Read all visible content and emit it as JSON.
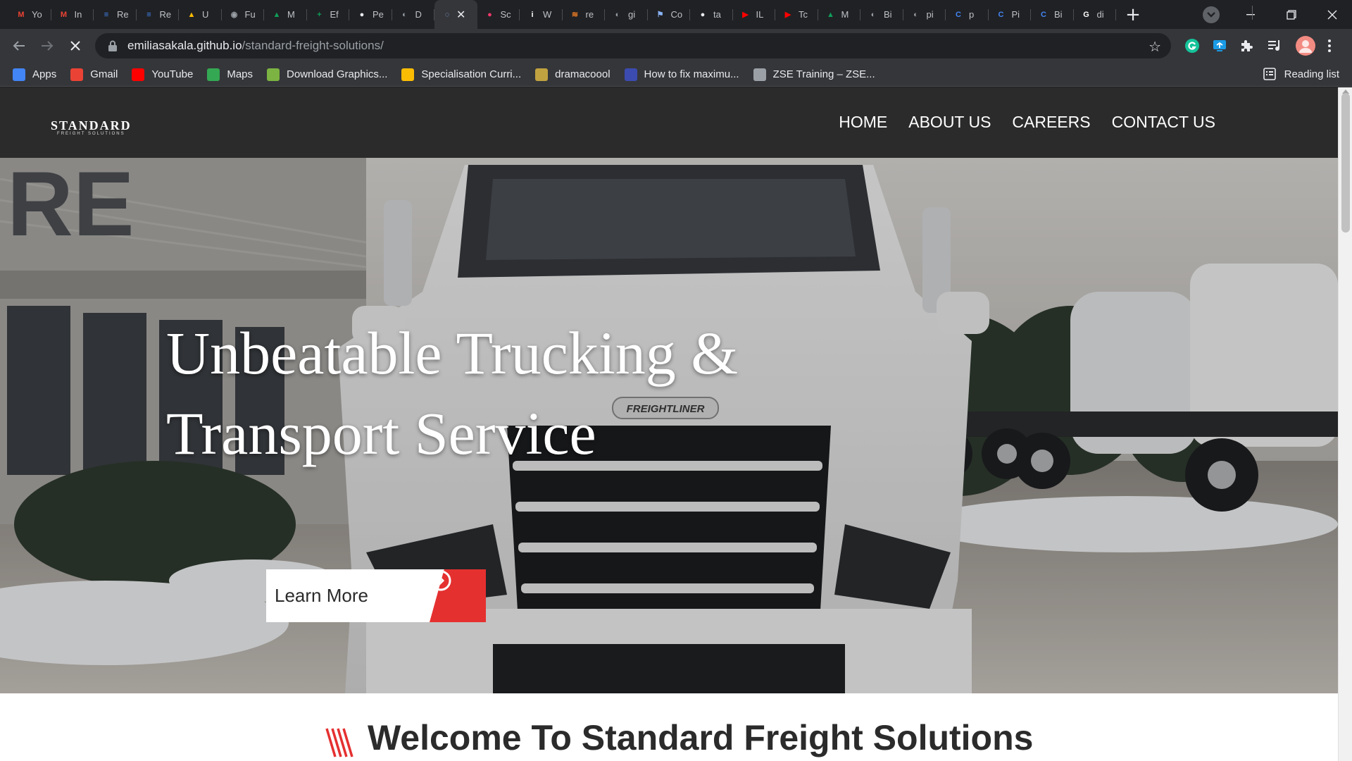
{
  "browser": {
    "tabs": [
      {
        "title": "Yo",
        "icon": "gmail-icon",
        "color": "#ea4335",
        "glyph": "M"
      },
      {
        "title": "In",
        "icon": "gmail-icon",
        "color": "#ea4335",
        "glyph": "M"
      },
      {
        "title": "Re",
        "icon": "docs-icon",
        "color": "#4285f4",
        "glyph": "≡"
      },
      {
        "title": "Re",
        "icon": "docs-icon",
        "color": "#4285f4",
        "glyph": "≡"
      },
      {
        "title": "U",
        "icon": "drive-icon",
        "color": "#fbbc04",
        "glyph": "▲"
      },
      {
        "title": "Fu",
        "icon": "hacker-icon",
        "color": "#9aa0a6",
        "glyph": "◉"
      },
      {
        "title": "M",
        "icon": "drive-icon",
        "color": "#0f9d58",
        "glyph": "▲"
      },
      {
        "title": "Ef",
        "icon": "sheets-icon",
        "color": "#0f9d58",
        "glyph": "+"
      },
      {
        "title": "Pe",
        "icon": "github-icon",
        "color": "#e8eaed",
        "glyph": "●"
      },
      {
        "title": "D",
        "icon": "globe-icon",
        "color": "#9aa0a6",
        "glyph": "◐"
      },
      {
        "title": "",
        "icon": "loading-icon",
        "color": "#8ab4f8",
        "glyph": "◌",
        "active": true
      },
      {
        "title": "Sc",
        "icon": "screen-icon",
        "color": "#f0386b",
        "glyph": "●"
      },
      {
        "title": "W",
        "icon": "info-icon",
        "color": "#ffffff",
        "glyph": "i"
      },
      {
        "title": "re",
        "icon": "stack-icon",
        "color": "#f48024",
        "glyph": "≋"
      },
      {
        "title": "gi",
        "icon": "globe-icon",
        "color": "#9aa0a6",
        "glyph": "◐"
      },
      {
        "title": "Co",
        "icon": "flag-icon",
        "color": "#8ab4f8",
        "glyph": "⚑"
      },
      {
        "title": "ta",
        "icon": "github-icon",
        "color": "#e8eaed",
        "glyph": "●"
      },
      {
        "title": "IL",
        "icon": "youtube-icon",
        "color": "#ff0000",
        "glyph": "▶"
      },
      {
        "title": "Tc",
        "icon": "youtube-icon",
        "color": "#ff0000",
        "glyph": "▶"
      },
      {
        "title": "M",
        "icon": "drive-icon",
        "color": "#0f9d58",
        "glyph": "▲"
      },
      {
        "title": "Bi",
        "icon": "globe-icon",
        "color": "#9aa0a6",
        "glyph": "◐"
      },
      {
        "title": "pi",
        "icon": "globe-icon",
        "color": "#9aa0a6",
        "glyph": "◐"
      },
      {
        "title": "p",
        "icon": "c-icon",
        "color": "#4285f4",
        "glyph": "C"
      },
      {
        "title": "Pi",
        "icon": "c-icon",
        "color": "#4285f4",
        "glyph": "C"
      },
      {
        "title": "Bi",
        "icon": "c-icon",
        "color": "#4285f4",
        "glyph": "C"
      },
      {
        "title": "di",
        "icon": "google-icon",
        "color": "#ffffff",
        "glyph": "G"
      }
    ],
    "url_host": "emiliasakala.github.io",
    "url_path": "/standard-freight-solutions/",
    "bookmarks": [
      {
        "label": "Apps",
        "icon": "apps-grid-icon",
        "color": "#4285f4"
      },
      {
        "label": "Gmail",
        "icon": "gmail-icon",
        "color": "#ea4335"
      },
      {
        "label": "YouTube",
        "icon": "youtube-icon",
        "color": "#ff0000"
      },
      {
        "label": "Maps",
        "icon": "maps-icon",
        "color": "#34a853"
      },
      {
        "label": "Download Graphics...",
        "icon": "leaf-icon",
        "color": "#7cb342"
      },
      {
        "label": "Specialisation Curri...",
        "icon": "drive-icon",
        "color": "#fbbc04"
      },
      {
        "label": "dramacoool",
        "icon": "drama-icon",
        "color": "#c0a240"
      },
      {
        "label": "How to fix maximu...",
        "icon": "screen-icon",
        "color": "#3c4bb0"
      },
      {
        "label": "ZSE Training – ZSE...",
        "icon": "zse-icon",
        "color": "#9aa0a6"
      }
    ],
    "reading_list": "Reading list"
  },
  "site": {
    "logo": "STANDARD",
    "logo_sub": "FREIGHT SOLUTIONS",
    "nav": [
      "HOME",
      "ABOUT US",
      "CAREERS",
      "CONTACT US"
    ],
    "hero_title_line1": "Unbeatable Trucking &",
    "hero_title_line2": "Transport Service",
    "cta_label": "Learn More",
    "accent": "#e53030",
    "welcome_heading": "Welcome To Standard Freight Solutions",
    "truck_badge": "FREIGHTLINER"
  }
}
